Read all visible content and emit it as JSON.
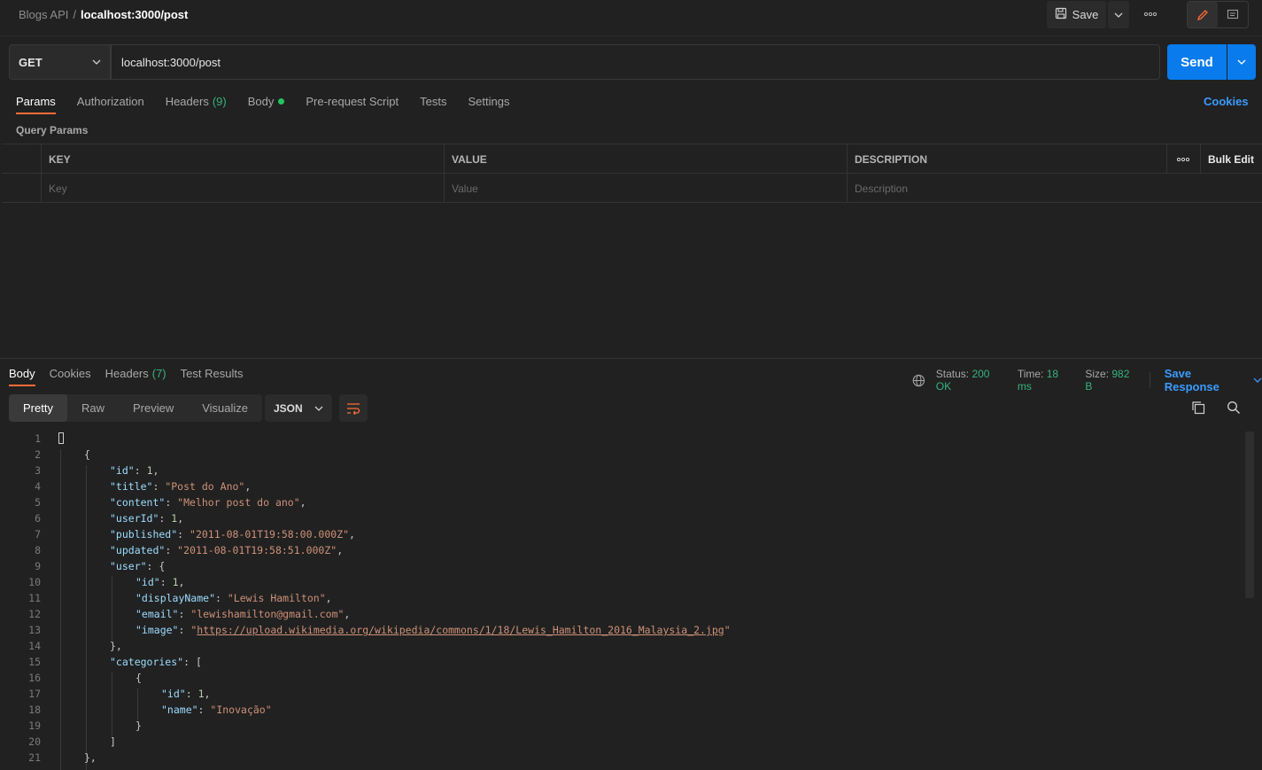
{
  "header": {
    "collection": "Blogs API",
    "separator": "/",
    "request_name": "localhost:3000/post",
    "save_label": "Save"
  },
  "request": {
    "method": "GET",
    "url": "localhost:3000/post",
    "send_label": "Send"
  },
  "req_tabs": [
    {
      "label": "Params"
    },
    {
      "label": "Authorization"
    },
    {
      "label": "Headers",
      "count": "(9)"
    },
    {
      "label": "Body"
    },
    {
      "label": "Pre-request Script"
    },
    {
      "label": "Tests"
    },
    {
      "label": "Settings"
    }
  ],
  "cookies_label": "Cookies",
  "query_params": {
    "title": "Query Params",
    "columns": [
      "KEY",
      "VALUE",
      "DESCRIPTION"
    ],
    "bulk_edit": "Bulk Edit",
    "placeholders": {
      "key": "Key",
      "value": "Value",
      "description": "Description"
    }
  },
  "response": {
    "tabs": [
      {
        "label": "Body"
      },
      {
        "label": "Cookies"
      },
      {
        "label": "Headers",
        "count": "(7)"
      },
      {
        "label": "Test Results"
      }
    ],
    "status_label": "Status:",
    "status_value": "200 OK",
    "time_label": "Time:",
    "time_value": "18 ms",
    "size_label": "Size:",
    "size_value": "982 B",
    "save_response": "Save Response",
    "views": [
      "Pretty",
      "Raw",
      "Preview",
      "Visualize"
    ],
    "format": "JSON"
  },
  "code_lines": [
    "1",
    "2",
    "3",
    "4",
    "5",
    "6",
    "7",
    "8",
    "9",
    "10",
    "11",
    "12",
    "13",
    "14",
    "15",
    "16",
    "17",
    "18",
    "19",
    "20",
    "21"
  ],
  "json_body": {
    "id_key": "\"id\"",
    "title_key": "\"title\"",
    "content_key": "\"content\"",
    "userId_key": "\"userId\"",
    "published_key": "\"published\"",
    "updated_key": "\"updated\"",
    "user_key": "\"user\"",
    "displayName_key": "\"displayName\"",
    "email_key": "\"email\"",
    "image_key": "\"image\"",
    "categories_key": "\"categories\"",
    "name_key": "\"name\"",
    "id_val": "1",
    "title_val": "\"Post do Ano\"",
    "content_val": "\"Melhor post do ano\"",
    "userId_val": "1",
    "published_val": "\"2011-08-01T19:58:00.000Z\"",
    "updated_val": "\"2011-08-01T19:58:51.000Z\"",
    "user_id_val": "1",
    "displayName_val": "\"Lewis Hamilton\"",
    "email_val": "\"lewishamilton@gmail.com\"",
    "image_url": "https://upload.wikimedia.org/wikipedia/commons/1/18/Lewis_Hamilton_2016_Malaysia_2.jpg",
    "cat_id_val": "1",
    "cat_name_val": "\"Inovação\""
  },
  "colors": {
    "accent": "#ff6c37",
    "send": "#097bed",
    "status_ok": "#36b37e",
    "link": "#3a9bff"
  }
}
